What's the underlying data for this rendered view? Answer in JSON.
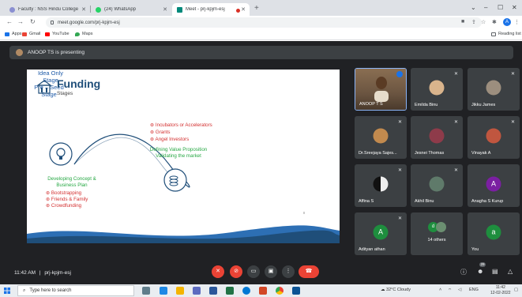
{
  "browser": {
    "tabs": [
      {
        "label": "Faculty : NSS Hindu College",
        "favicon_color": "#8a8fd1"
      },
      {
        "label": "(24) WhatsApp",
        "favicon_color": "#25d366"
      },
      {
        "label": "Meet - prj-kpjm-esj",
        "favicon_color": "#00897b",
        "active": true
      }
    ],
    "new_tab": "+",
    "url": "meet.google.com/prj-kpjm-esj",
    "bookmarks": [
      "Apps",
      "Gmail",
      "YouTube",
      "Maps"
    ],
    "reading_list": "Reading list",
    "profile_initial": "A"
  },
  "meet": {
    "presenting_banner": "ANOOP TS is presenting",
    "slide": {
      "title": "Funding",
      "subtitle": "Stages",
      "idea_stage": "Idea Only\nStage",
      "concept_text": "Developing Concept &\nBusiness Plan",
      "concept_items": [
        "⊛ Bootstrapping",
        "⊛ Friends & Family",
        "⊛ Crowdfunding"
      ],
      "support_items": [
        "⊛ Incubators or Accelerators",
        "⊛ Grants",
        "⊛ Angel Investors"
      ],
      "value_text": "Defining Value Proposition\nValidating the market",
      "preseed_stage": "Pre – Seed\nStage"
    },
    "participants": [
      {
        "name": "ANOOP T S",
        "type": "video"
      },
      {
        "name": "Emilda Binu",
        "type": "photo"
      },
      {
        "name": "Jikku James",
        "type": "photo"
      },
      {
        "name": "Dr.Sreejaya Sajes...",
        "type": "photo"
      },
      {
        "name": "Jesnei Thomas",
        "type": "photo"
      },
      {
        "name": "Vinayak A",
        "type": "photo"
      },
      {
        "name": "Affina S",
        "type": "photo"
      },
      {
        "name": "Akhil Binu",
        "type": "photo"
      },
      {
        "name": "Anagha S Kurup",
        "type": "letter",
        "letter": "A",
        "color": "#7b1fa2"
      },
      {
        "name": "Adityan athan",
        "type": "letter",
        "letter": "A",
        "color": "#1e8e3e"
      },
      {
        "name": "14 others",
        "type": "others"
      },
      {
        "name": "You",
        "type": "letter",
        "letter": "a",
        "color": "#1e8e3e"
      }
    ],
    "others_letter": "d",
    "time": "11:42 AM",
    "meeting_code": "prj-kpjm-esj",
    "participant_count": "29"
  },
  "taskbar": {
    "search_placeholder": "Type here to search",
    "weather": "32°C  Cloudy",
    "lang": "ENG",
    "time": "11:42",
    "date": "12-02-2022"
  }
}
